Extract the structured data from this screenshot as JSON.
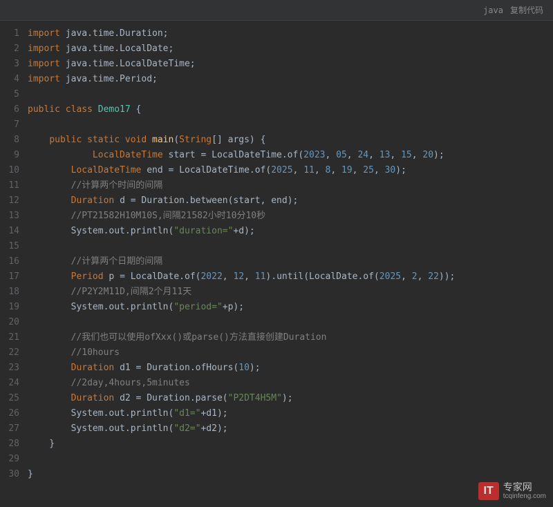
{
  "header": {
    "language": "java",
    "copy_label": "复制代码"
  },
  "code": {
    "lines": [
      [
        {
          "t": "kw",
          "v": "import"
        },
        {
          "t": "plain",
          "v": " java.time.Duration;"
        }
      ],
      [
        {
          "t": "kw",
          "v": "import"
        },
        {
          "t": "plain",
          "v": " java.time.LocalDate;"
        }
      ],
      [
        {
          "t": "kw",
          "v": "import"
        },
        {
          "t": "plain",
          "v": " java.time.LocalDateTime;"
        }
      ],
      [
        {
          "t": "kw",
          "v": "import"
        },
        {
          "t": "plain",
          "v": " java.time.Period;"
        }
      ],
      [],
      [
        {
          "t": "kw",
          "v": "public class "
        },
        {
          "t": "cls",
          "v": "Demo17"
        },
        {
          "t": "plain",
          "v": " {"
        }
      ],
      [],
      [
        {
          "t": "plain",
          "v": "    "
        },
        {
          "t": "kw",
          "v": "public static void "
        },
        {
          "t": "method",
          "v": "main"
        },
        {
          "t": "plain",
          "v": "("
        },
        {
          "t": "type",
          "v": "String"
        },
        {
          "t": "plain",
          "v": "[] args) {"
        }
      ],
      [
        {
          "t": "plain",
          "v": "            "
        },
        {
          "t": "type",
          "v": "LocalDateTime"
        },
        {
          "t": "plain",
          "v": " start = LocalDateTime.of("
        },
        {
          "t": "num",
          "v": "2023"
        },
        {
          "t": "plain",
          "v": ", "
        },
        {
          "t": "num",
          "v": "05"
        },
        {
          "t": "plain",
          "v": ", "
        },
        {
          "t": "num",
          "v": "24"
        },
        {
          "t": "plain",
          "v": ", "
        },
        {
          "t": "num",
          "v": "13"
        },
        {
          "t": "plain",
          "v": ", "
        },
        {
          "t": "num",
          "v": "15"
        },
        {
          "t": "plain",
          "v": ", "
        },
        {
          "t": "num",
          "v": "20"
        },
        {
          "t": "plain",
          "v": ");"
        }
      ],
      [
        {
          "t": "plain",
          "v": "        "
        },
        {
          "t": "type",
          "v": "LocalDateTime"
        },
        {
          "t": "plain",
          "v": " end = LocalDateTime.of("
        },
        {
          "t": "num",
          "v": "2025"
        },
        {
          "t": "plain",
          "v": ", "
        },
        {
          "t": "num",
          "v": "11"
        },
        {
          "t": "plain",
          "v": ", "
        },
        {
          "t": "num",
          "v": "8"
        },
        {
          "t": "plain",
          "v": ", "
        },
        {
          "t": "num",
          "v": "19"
        },
        {
          "t": "plain",
          "v": ", "
        },
        {
          "t": "num",
          "v": "25"
        },
        {
          "t": "plain",
          "v": ", "
        },
        {
          "t": "num",
          "v": "30"
        },
        {
          "t": "plain",
          "v": ");"
        }
      ],
      [
        {
          "t": "plain",
          "v": "        "
        },
        {
          "t": "comment",
          "v": "//计算两个时间的间隔"
        }
      ],
      [
        {
          "t": "plain",
          "v": "        "
        },
        {
          "t": "type",
          "v": "Duration"
        },
        {
          "t": "plain",
          "v": " d = Duration.between(start, end);"
        }
      ],
      [
        {
          "t": "plain",
          "v": "        "
        },
        {
          "t": "comment",
          "v": "//PT21582H10M10S,间隔21582小时10分10秒"
        }
      ],
      [
        {
          "t": "plain",
          "v": "        System.out.println("
        },
        {
          "t": "str",
          "v": "\"duration=\""
        },
        {
          "t": "plain",
          "v": "+d);"
        }
      ],
      [],
      [
        {
          "t": "plain",
          "v": "        "
        },
        {
          "t": "comment",
          "v": "//计算两个日期的间隔"
        }
      ],
      [
        {
          "t": "plain",
          "v": "        "
        },
        {
          "t": "type",
          "v": "Period"
        },
        {
          "t": "plain",
          "v": " p = LocalDate.of("
        },
        {
          "t": "num",
          "v": "2022"
        },
        {
          "t": "plain",
          "v": ", "
        },
        {
          "t": "num",
          "v": "12"
        },
        {
          "t": "plain",
          "v": ", "
        },
        {
          "t": "num",
          "v": "11"
        },
        {
          "t": "plain",
          "v": ").until(LocalDate.of("
        },
        {
          "t": "num",
          "v": "2025"
        },
        {
          "t": "plain",
          "v": ", "
        },
        {
          "t": "num",
          "v": "2"
        },
        {
          "t": "plain",
          "v": ", "
        },
        {
          "t": "num",
          "v": "22"
        },
        {
          "t": "plain",
          "v": "));"
        }
      ],
      [
        {
          "t": "plain",
          "v": "        "
        },
        {
          "t": "comment",
          "v": "//P2Y2M11D,间隔2个月11天"
        }
      ],
      [
        {
          "t": "plain",
          "v": "        System.out.println("
        },
        {
          "t": "str",
          "v": "\"period=\""
        },
        {
          "t": "plain",
          "v": "+p);"
        }
      ],
      [],
      [
        {
          "t": "plain",
          "v": "        "
        },
        {
          "t": "comment",
          "v": "//我们也可以使用ofXxx()或parse()方法直接创建Duration"
        }
      ],
      [
        {
          "t": "plain",
          "v": "        "
        },
        {
          "t": "comment",
          "v": "//10hours"
        }
      ],
      [
        {
          "t": "plain",
          "v": "        "
        },
        {
          "t": "type",
          "v": "Duration"
        },
        {
          "t": "plain",
          "v": " d1 = Duration.ofHours("
        },
        {
          "t": "num",
          "v": "10"
        },
        {
          "t": "plain",
          "v": ");"
        }
      ],
      [
        {
          "t": "plain",
          "v": "        "
        },
        {
          "t": "comment",
          "v": "//2day,4hours,5minutes"
        }
      ],
      [
        {
          "t": "plain",
          "v": "        "
        },
        {
          "t": "type",
          "v": "Duration"
        },
        {
          "t": "plain",
          "v": " d2 = Duration.parse("
        },
        {
          "t": "str",
          "v": "\"P2DT4H5M\""
        },
        {
          "t": "plain",
          "v": ");"
        }
      ],
      [
        {
          "t": "plain",
          "v": "        System.out.println("
        },
        {
          "t": "str",
          "v": "\"d1=\""
        },
        {
          "t": "plain",
          "v": "+d1);"
        }
      ],
      [
        {
          "t": "plain",
          "v": "        System.out.println("
        },
        {
          "t": "str",
          "v": "\"d2=\""
        },
        {
          "t": "plain",
          "v": "+d2);"
        }
      ],
      [
        {
          "t": "plain",
          "v": "    }"
        }
      ],
      [],
      [
        {
          "t": "plain",
          "v": "}"
        }
      ]
    ]
  },
  "watermark": {
    "badge": "IT",
    "title": "专家网",
    "sub": "tcqinfeng.com"
  }
}
